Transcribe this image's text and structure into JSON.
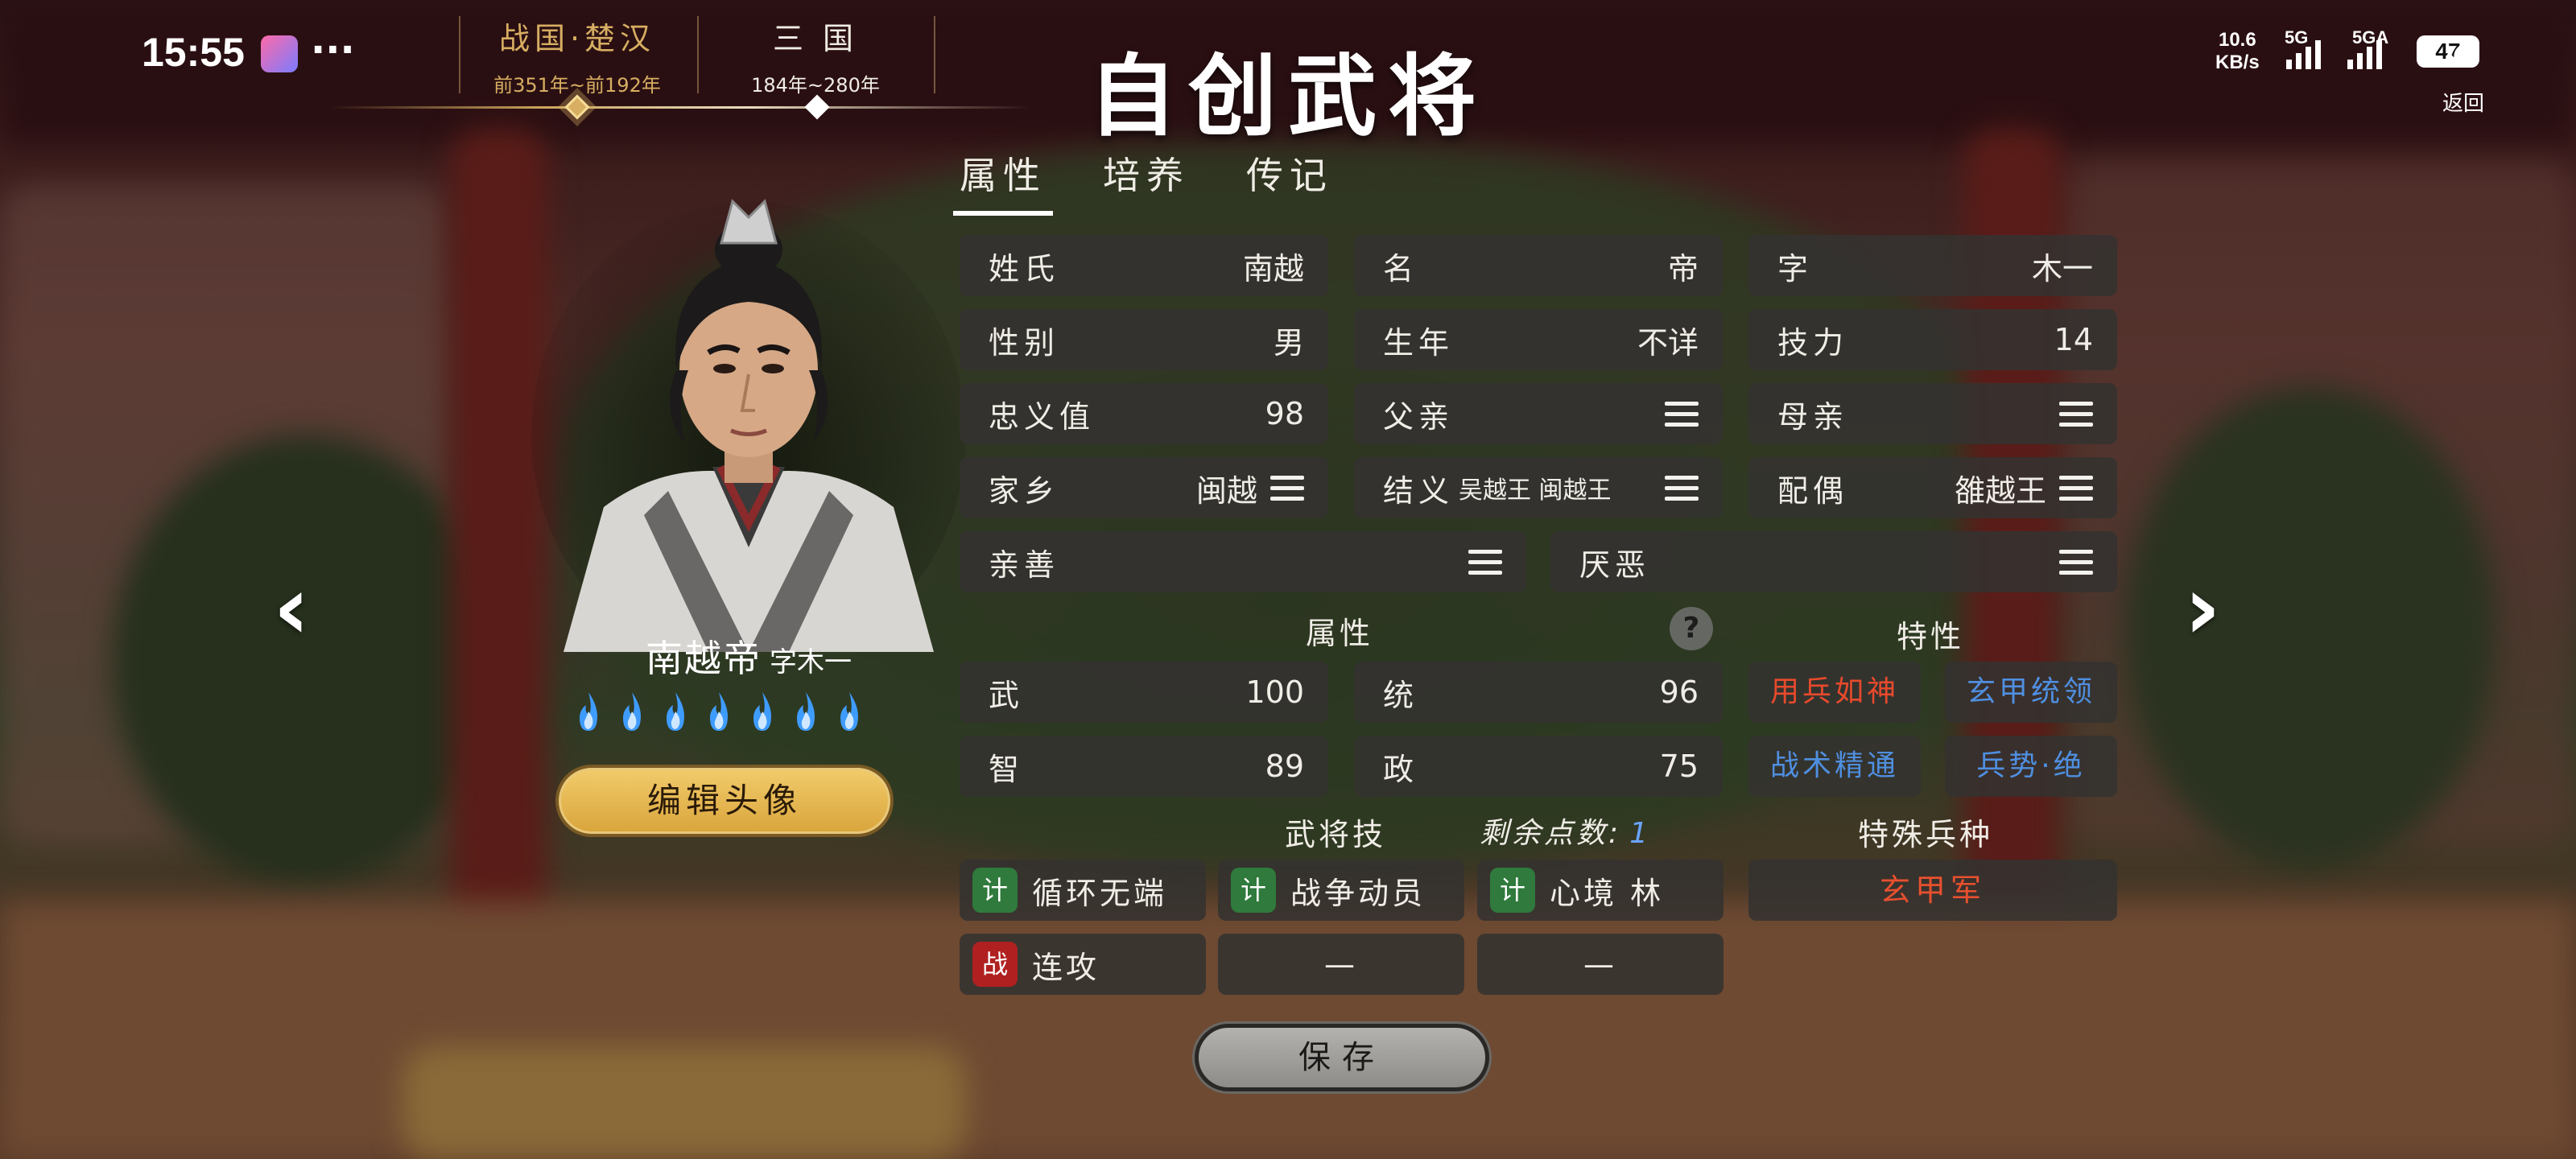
{
  "status_bar": {
    "time": "15:55",
    "more": "···",
    "net_speed_value": "10.6",
    "net_speed_unit": "KB/s",
    "signal_1": "5G",
    "signal_2": "5GA",
    "battery": "47"
  },
  "eras": [
    {
      "name": "战国·楚汉",
      "range": "前351年~前192年"
    },
    {
      "name": "三 国",
      "range": "184年~280年"
    }
  ],
  "page_title": "自创武将",
  "back_label": "返回",
  "tabs": [
    {
      "label": "属性"
    },
    {
      "label": "培养"
    },
    {
      "label": "传记"
    }
  ],
  "hero": {
    "name": "南越帝",
    "courtesy": "字木一",
    "edit_avatar_label": "编辑头像"
  },
  "info": {
    "surname": {
      "label": "姓氏",
      "value": "南越"
    },
    "given_name": {
      "label": "名",
      "value": "帝"
    },
    "courtesy": {
      "label": "字",
      "value": "木一"
    },
    "gender": {
      "label": "性别",
      "value": "男"
    },
    "birth_year": {
      "label": "生年",
      "value": "不详"
    },
    "skill_power": {
      "label": "技力",
      "value": "14"
    },
    "loyalty": {
      "label": "忠义值",
      "value": "98"
    },
    "father": {
      "label": "父亲"
    },
    "mother": {
      "label": "母亲"
    },
    "hometown": {
      "label": "家乡",
      "value": "闽越"
    },
    "sworn": {
      "label": "结义",
      "value": "吴越王 闽越王"
    },
    "spouse": {
      "label": "配偶",
      "value": "雒越王"
    },
    "affinity": {
      "label": "亲善"
    },
    "aversion": {
      "label": "厌恶"
    }
  },
  "attributes": {
    "title": "属性",
    "help": "?",
    "war": {
      "label": "武",
      "value": "100"
    },
    "command": {
      "label": "统",
      "value": "96"
    },
    "intelligence": {
      "label": "智",
      "value": "89"
    },
    "politics": {
      "label": "政",
      "value": "75"
    }
  },
  "traits": {
    "title": "特性",
    "items": [
      {
        "label": "用兵如神",
        "color": "#e84a2c"
      },
      {
        "label": "玄甲统领",
        "color": "#4f8fe0"
      },
      {
        "label": "战术精通",
        "color": "#4f8fe0"
      },
      {
        "label": "兵势·绝",
        "color": "#4f8fe0"
      }
    ]
  },
  "skills": {
    "title": "武将技",
    "points_label": "剩余点数:",
    "points_value": "1",
    "items": [
      {
        "tag": "计",
        "label": "循环无端"
      },
      {
        "tag": "计",
        "label": "战争动员"
      },
      {
        "tag": "计",
        "label": "心境 林"
      },
      {
        "tag": "战",
        "label": "连攻"
      },
      {
        "tag": "",
        "label": "—"
      },
      {
        "tag": "",
        "label": "—"
      }
    ]
  },
  "special_unit": {
    "title": "特殊兵种",
    "value": "玄甲军"
  },
  "save_label": "保存"
}
